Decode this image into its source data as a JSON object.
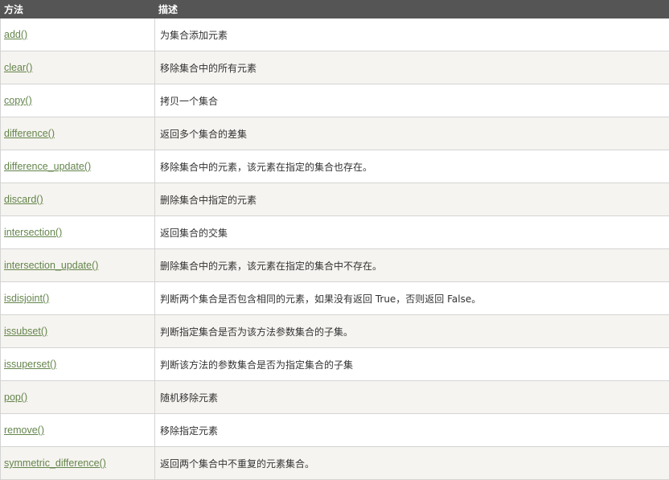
{
  "header": {
    "method": "方法",
    "description": "描述"
  },
  "rows": [
    {
      "method": "add()",
      "description": "为集合添加元素"
    },
    {
      "method": "clear()",
      "description": "移除集合中的所有元素"
    },
    {
      "method": "copy()",
      "description": "拷贝一个集合"
    },
    {
      "method": "difference()",
      "description": "返回多个集合的差集"
    },
    {
      "method": "difference_update()",
      "description": "移除集合中的元素，该元素在指定的集合也存在。"
    },
    {
      "method": "discard()",
      "description": "删除集合中指定的元素"
    },
    {
      "method": "intersection()",
      "description": "返回集合的交集"
    },
    {
      "method": "intersection_update()",
      "description": "删除集合中的元素，该元素在指定的集合中不存在。"
    },
    {
      "method": "isdisjoint()",
      "description": "判断两个集合是否包含相同的元素，如果没有返回 True，否则返回 False。"
    },
    {
      "method": "issubset()",
      "description": "判断指定集合是否为该方法参数集合的子集。"
    },
    {
      "method": "issuperset()",
      "description": "判断该方法的参数集合是否为指定集合的子集"
    },
    {
      "method": "pop()",
      "description": "随机移除元素"
    },
    {
      "method": "remove()",
      "description": "移除指定元素"
    },
    {
      "method": "symmetric_difference()",
      "description": "返回两个集合中不重复的元素集合。"
    }
  ],
  "colors": {
    "header_bg": "#555555",
    "link": "#64854c",
    "row_alt": "#f6f4f0"
  }
}
